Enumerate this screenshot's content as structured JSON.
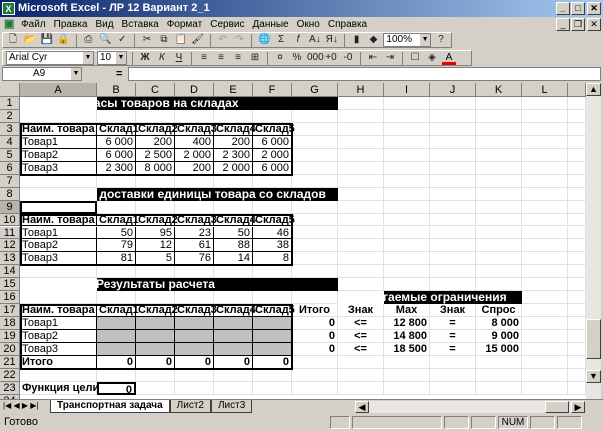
{
  "window": {
    "title": "Microsoft Excel - ЛР 12 Вариант 2_1",
    "app_icon": "excel-icon"
  },
  "menu": [
    "Файл",
    "Правка",
    "Вид",
    "Вставка",
    "Формат",
    "Сервис",
    "Данные",
    "Окно",
    "Справка"
  ],
  "toolbar": {
    "zoom": "100%",
    "font": "Arial Cyr",
    "size": "10"
  },
  "formula": {
    "name_box": "A9",
    "eq": "=",
    "value": ""
  },
  "columns": [
    "A",
    "B",
    "C",
    "D",
    "E",
    "F",
    "G",
    "H",
    "I",
    "J",
    "K",
    "L"
  ],
  "rows": [
    [
      "Запасы товаров на складах",
      "",
      "",
      "",
      "",
      "",
      "",
      "",
      "",
      "",
      "",
      ""
    ],
    [
      "",
      "",
      "",
      "",
      "",
      "",
      "",
      "",
      "",
      "",
      "",
      ""
    ],
    [
      "Наим. товара",
      "Склад1",
      "Склад2",
      "Склад3",
      "Склад4",
      "Склад5",
      "",
      "",
      "",
      "",
      "",
      ""
    ],
    [
      "Товар1",
      "6 000",
      "200",
      "400",
      "200",
      "6 000",
      "",
      "",
      "",
      "",
      "",
      ""
    ],
    [
      "Товар2",
      "6 000",
      "2 500",
      "2 000",
      "2 300",
      "2 000",
      "",
      "",
      "",
      "",
      "",
      ""
    ],
    [
      "Товар3",
      "2 300",
      "8 000",
      "200",
      "2 000",
      "6 000",
      "",
      "",
      "",
      "",
      "",
      ""
    ],
    [
      "",
      "",
      "",
      "",
      "",
      "",
      "",
      "",
      "",
      "",
      "",
      ""
    ],
    [
      "Стоимость доставки единицы товара со складов",
      "",
      "",
      "",
      "",
      "",
      "",
      "",
      "",
      "",
      "",
      ""
    ],
    [
      "",
      "",
      "",
      "",
      "",
      "",
      "",
      "",
      "",
      "",
      "",
      ""
    ],
    [
      "Наим. товара",
      "Склад1",
      "Склад2",
      "Склад3",
      "Склад4",
      "Склад5",
      "",
      "",
      "",
      "",
      "",
      ""
    ],
    [
      "Товар1",
      "50",
      "95",
      "23",
      "50",
      "46",
      "",
      "",
      "",
      "",
      "",
      ""
    ],
    [
      "Товар2",
      "79",
      "12",
      "61",
      "88",
      "38",
      "",
      "",
      "",
      "",
      "",
      ""
    ],
    [
      "Товар3",
      "81",
      "5",
      "76",
      "14",
      "8",
      "",
      "",
      "",
      "",
      "",
      ""
    ],
    [
      "",
      "",
      "",
      "",
      "",
      "",
      "",
      "",
      "",
      "",
      "",
      ""
    ],
    [
      "Результаты расчета",
      "",
      "",
      "",
      "",
      "",
      "",
      "",
      "",
      "",
      "",
      ""
    ],
    [
      "",
      "",
      "",
      "",
      "",
      "",
      "",
      "Налагаемые ограничения",
      "",
      "",
      "",
      ""
    ],
    [
      "Наим. товара",
      "Склад1",
      "Склад2",
      "Склад3",
      "Склад4",
      "Склад5",
      "Итого",
      "Знак",
      "Max",
      "Знак",
      "Спрос",
      ""
    ],
    [
      "Товар1",
      "",
      "",
      "",
      "",
      "",
      "0",
      "<=",
      "12 800",
      "=",
      "8 000",
      ""
    ],
    [
      "Товар2",
      "",
      "",
      "",
      "",
      "",
      "0",
      "<=",
      "14 800",
      "=",
      "9 000",
      ""
    ],
    [
      "Товар3",
      "",
      "",
      "",
      "",
      "",
      "0",
      "<=",
      "18 500",
      "=",
      "15 000",
      ""
    ],
    [
      "Итого",
      "0",
      "0",
      "0",
      "0",
      "0",
      "",
      "",
      "",
      "",
      "",
      ""
    ],
    [
      "",
      "",
      "",
      "",
      "",
      "",
      "",
      "",
      "",
      "",
      "",
      ""
    ],
    [
      "Функция цели",
      "0",
      "",
      "",
      "",
      "",
      "",
      "",
      "",
      "",
      "",
      ""
    ]
  ],
  "sheet_tabs": [
    "Транспортная задача",
    "Лист2",
    "Лист3"
  ],
  "active_tab": 0,
  "status": {
    "text": "Готово",
    "num": "NUM"
  },
  "colors": {
    "header_band": "#000000",
    "input_cells": "#c0c0c0"
  }
}
